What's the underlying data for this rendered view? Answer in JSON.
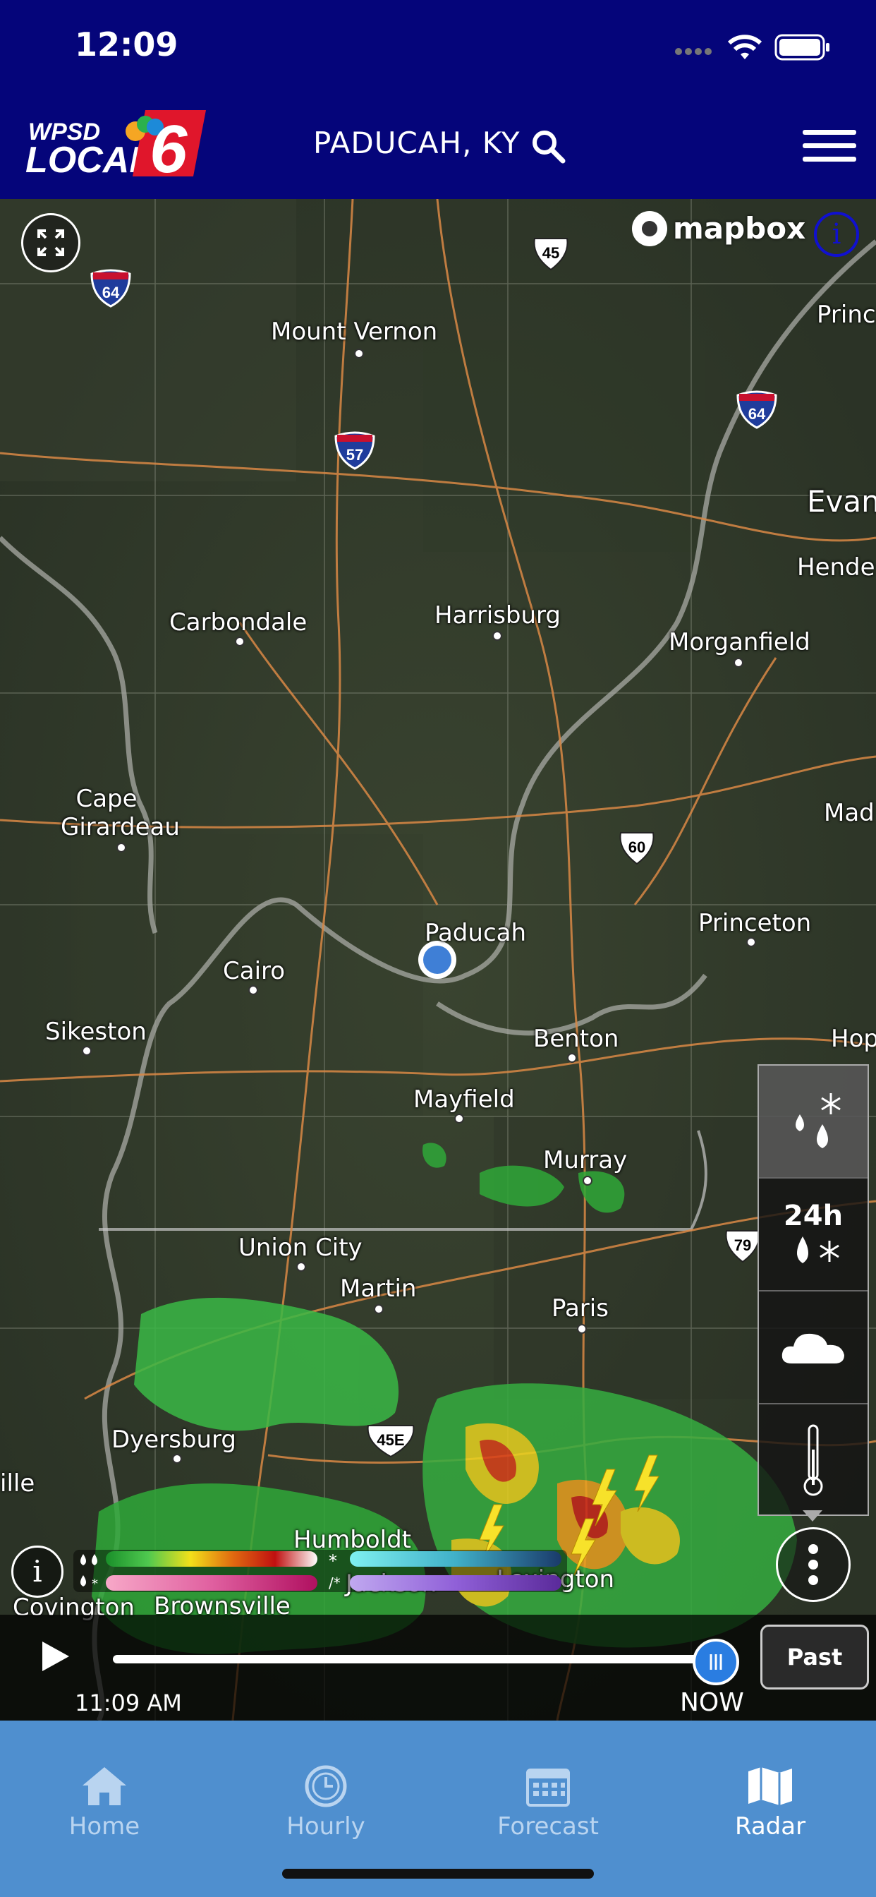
{
  "status": {
    "time": "12:09"
  },
  "header": {
    "location": "PADUCAH, KY",
    "logo_text_top": "WPSD",
    "logo_text_bottom": "LOCAL",
    "logo_number": "6"
  },
  "map": {
    "attribution": "mapbox",
    "cities": [
      {
        "name": "Mount Vernon"
      },
      {
        "name": "Carbondale"
      },
      {
        "name": "Harrisburg"
      },
      {
        "name": "Morganfield"
      },
      {
        "name": "Cape Girardeau"
      },
      {
        "name": "Paducah"
      },
      {
        "name": "Princeton"
      },
      {
        "name": "Cairo"
      },
      {
        "name": "Sikeston"
      },
      {
        "name": "Benton"
      },
      {
        "name": "Mayfield"
      },
      {
        "name": "Murray"
      },
      {
        "name": "Union City"
      },
      {
        "name": "Martin"
      },
      {
        "name": "Paris"
      },
      {
        "name": "Dyersburg"
      },
      {
        "name": "Humboldt"
      },
      {
        "name": "Jackson"
      },
      {
        "name": "Lexington"
      },
      {
        "name": "Brownsville"
      },
      {
        "name": "Covington"
      }
    ],
    "highways": [
      "64",
      "45",
      "57",
      "64",
      "60",
      "79",
      "45E"
    ],
    "edge_labels": [
      "Princ",
      "Evans",
      "Hende",
      "Mad",
      "Hop",
      "ille"
    ]
  },
  "layers": {
    "precip_label": "24h"
  },
  "timeline": {
    "start_time": "11:09 AM",
    "now_label": "NOW",
    "mode_button": "Past",
    "progress": 0.95
  },
  "nav": {
    "tabs": [
      {
        "label": "Home",
        "icon": "home-icon",
        "active": false
      },
      {
        "label": "Hourly",
        "icon": "clock-icon",
        "active": false
      },
      {
        "label": "Forecast",
        "icon": "calendar-icon",
        "active": false
      },
      {
        "label": "Radar",
        "icon": "map-icon",
        "active": true
      }
    ]
  },
  "colors": {
    "header_bg": "#05057a",
    "nav_bg": "#4f8fcf",
    "accent": "#2a7de1"
  }
}
